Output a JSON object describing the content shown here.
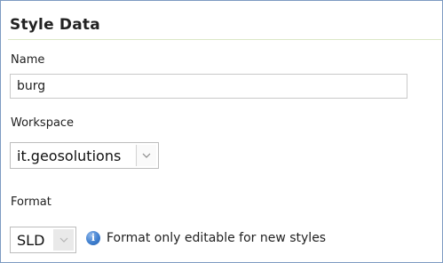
{
  "section": {
    "title": "Style Data"
  },
  "name_field": {
    "label": "Name",
    "value": "burg"
  },
  "workspace_field": {
    "label": "Workspace",
    "selected": "it.geosolutions"
  },
  "format_field": {
    "label": "Format",
    "selected": "SLD",
    "disabled": true,
    "note": "Format only editable for new styles",
    "note_icon": "info-icon"
  },
  "colors": {
    "frame_border": "#7d9bc2",
    "title_rule": "#dbe8c6",
    "info_icon": "#3f7fcf"
  }
}
